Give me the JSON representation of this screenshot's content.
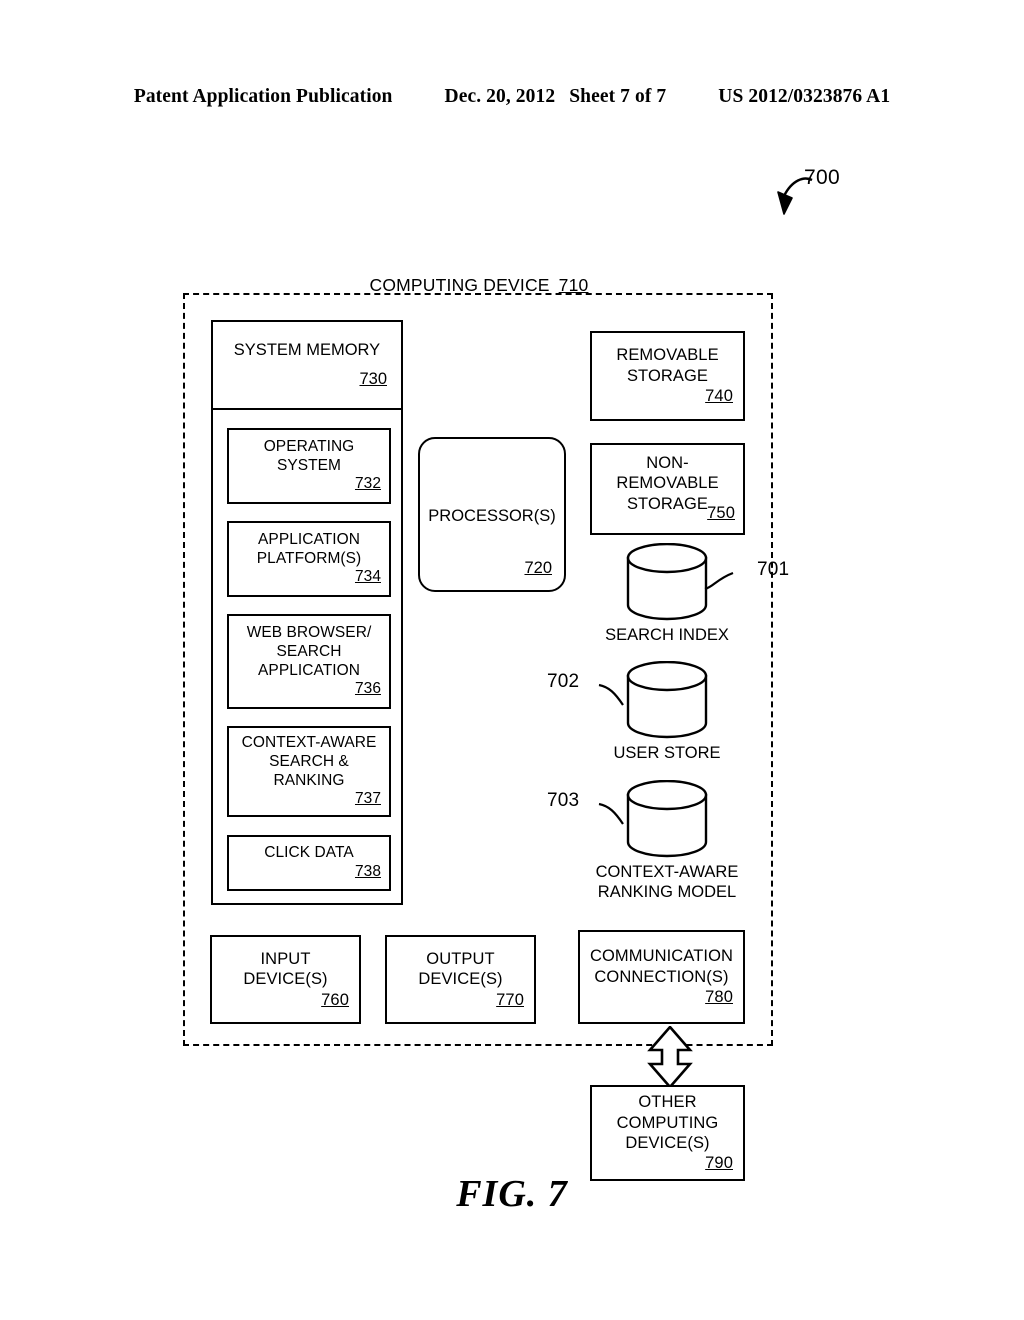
{
  "header": {
    "publication": "Patent Application Publication",
    "date": "Dec. 20, 2012",
    "sheet": "Sheet 7 of 7",
    "patent_number": "US 2012/0323876 A1"
  },
  "figure": {
    "caption": "FIG. 7",
    "reference_number": "700"
  },
  "diagram": {
    "title": "COMPUTING DEVICE",
    "title_number": "710",
    "system_memory": {
      "label": "SYSTEM MEMORY",
      "number": "730",
      "components": [
        {
          "lines": [
            "OPERATING",
            "SYSTEM"
          ],
          "number": "732"
        },
        {
          "lines": [
            "APPLICATION",
            "PLATFORM(S)"
          ],
          "number": "734"
        },
        {
          "lines": [
            "WEB BROWSER/",
            "SEARCH",
            "APPLICATION"
          ],
          "number": "736"
        },
        {
          "lines": [
            "CONTEXT-AWARE",
            "SEARCH &",
            "RANKING"
          ],
          "number": "737"
        },
        {
          "lines": [
            "CLICK DATA"
          ],
          "number": "738"
        }
      ]
    },
    "processor": {
      "label": "PROCESSOR(S)",
      "number": "720"
    },
    "storage": [
      {
        "lines": [
          "REMOVABLE",
          "STORAGE"
        ],
        "number": "740"
      },
      {
        "lines": [
          "NON-",
          "REMOVABLE",
          "STORAGE"
        ],
        "number": "750"
      }
    ],
    "data_stores": [
      {
        "lines": [
          "SEARCH INDEX"
        ],
        "number": "701",
        "number_side": "right"
      },
      {
        "lines": [
          "USER STORE"
        ],
        "number": "702",
        "number_side": "left"
      },
      {
        "lines": [
          "CONTEXT-AWARE",
          "RANKING MODEL"
        ],
        "number": "703",
        "number_side": "left"
      }
    ],
    "io_blocks": [
      {
        "lines": [
          "INPUT",
          "DEVICE(S)"
        ],
        "number": "760"
      },
      {
        "lines": [
          "OUTPUT",
          "DEVICE(S)"
        ],
        "number": "770"
      },
      {
        "lines": [
          "COMMUNICATION",
          "CONNECTION(S)"
        ],
        "number": "780"
      }
    ],
    "external": {
      "lines": [
        "OTHER",
        "COMPUTING",
        "DEVICE(S)"
      ],
      "number": "790"
    }
  }
}
